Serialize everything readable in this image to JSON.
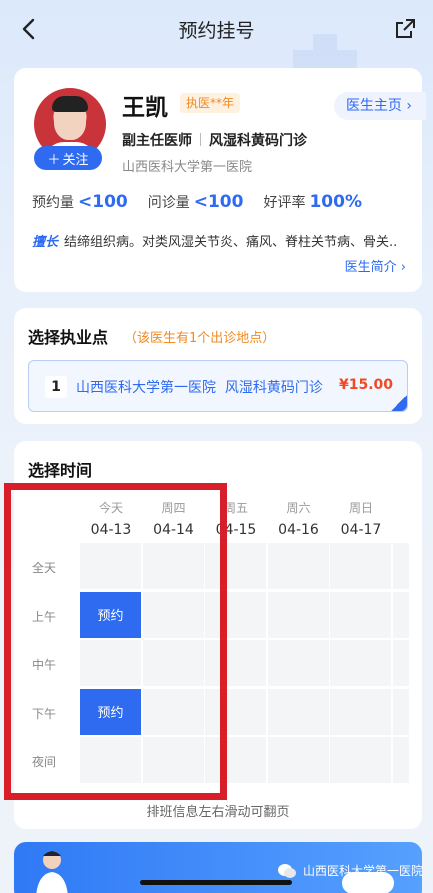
{
  "nav": {
    "title": "预约挂号",
    "back_icon": "chevron-left-icon",
    "share_icon": "share-icon"
  },
  "doctor": {
    "name": "王凯",
    "badge": "执医**年",
    "home_label": "医生主页",
    "follow_label": "关注",
    "title": "副主任医师",
    "department": "风湿科黄码门诊",
    "hospital": "山西医科大学第一医院",
    "stats": [
      {
        "label": "预约量",
        "value": "<100"
      },
      {
        "label": "问诊量",
        "value": "<100"
      },
      {
        "label": "好评率",
        "value": "100%"
      }
    ],
    "expert_tag": "擅长",
    "expertise": "结缔组织病。对类风湿关节炎、痛风、脊柱关节病、骨关..",
    "intro_label": "医生简介"
  },
  "location": {
    "section_title": "选择执业点",
    "note": "（该医生有1个出诊地点）",
    "options": [
      {
        "index": "1",
        "hospital": "山西医科大学第一医院",
        "department": "风湿科黄码门诊",
        "price": "¥15.00"
      }
    ]
  },
  "schedule": {
    "section_title": "选择时间",
    "days": [
      {
        "week": "今天",
        "date": "04-13"
      },
      {
        "week": "周四",
        "date": "04-14"
      },
      {
        "week": "周五",
        "date": "04-15"
      },
      {
        "week": "周六",
        "date": "04-16"
      },
      {
        "week": "周日",
        "date": "04-17"
      }
    ],
    "rows": [
      "全天",
      "上午",
      "中午",
      "下午",
      "夜间"
    ],
    "book_label": "预约",
    "bookable": [
      {
        "day": 0,
        "row": 1
      },
      {
        "day": 0,
        "row": 3
      }
    ],
    "scroll_tip": "排班信息左右滑动可翻页"
  },
  "watermark": "山西医科大学第一医院",
  "colors": {
    "accent": "#2f6bf0",
    "highlight": "#d81e28",
    "price": "#f04a24",
    "note": "#f08a24"
  }
}
